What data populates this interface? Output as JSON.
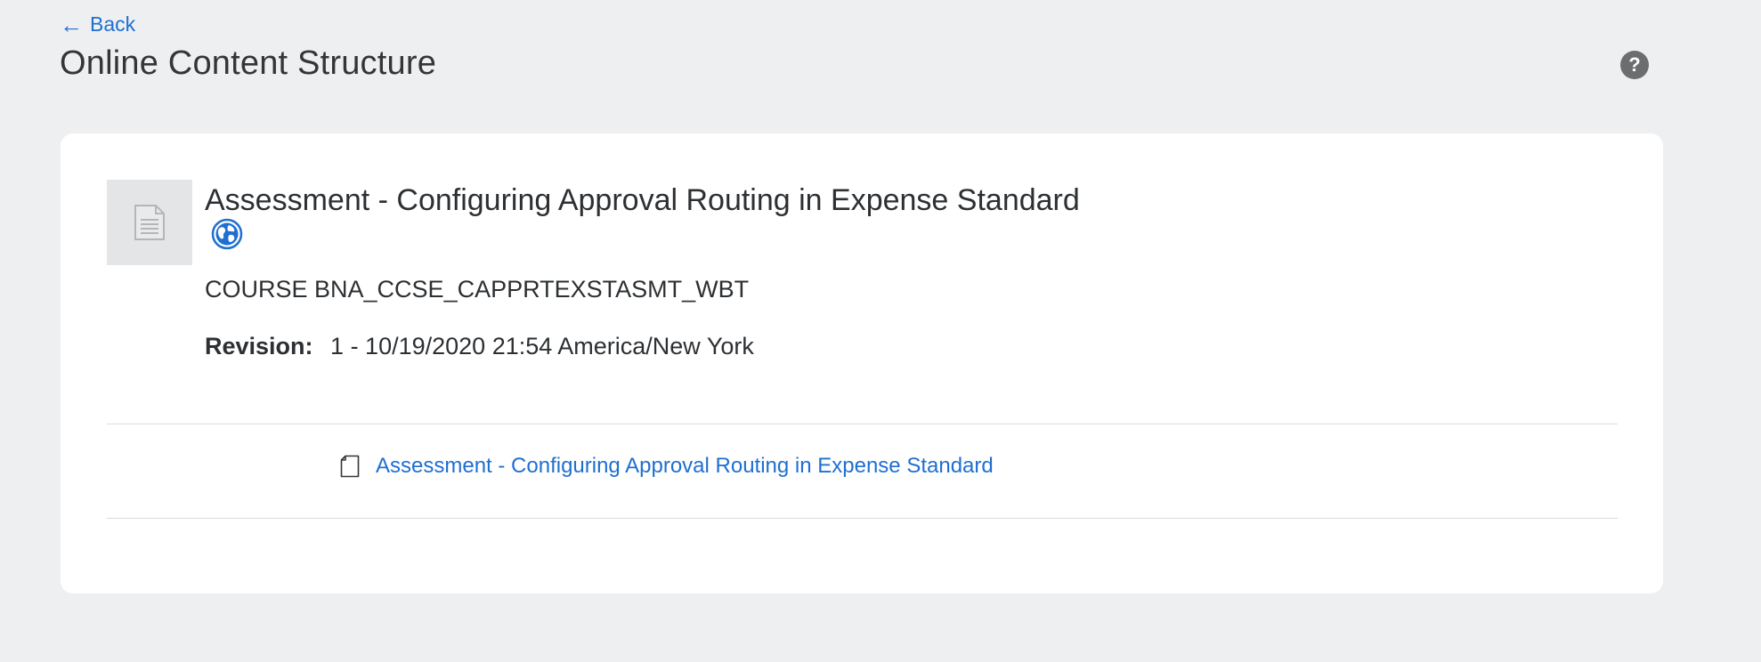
{
  "nav": {
    "back_arrow": "←",
    "back_label": "Back"
  },
  "header": {
    "title": "Online Content Structure",
    "help_symbol": "?"
  },
  "item": {
    "thumbnail_icon": "document-icon",
    "title": "Assessment - Configuring Approval Routing in Expense Standard",
    "globe_icon": "globe-icon",
    "course_code": "COURSE BNA_CCSE_CAPPRTEXSTASMT_WBT",
    "revision_label": "Revision:",
    "revision_value": "1 - 10/19/2020 21:54 America/New York"
  },
  "structure": {
    "items": [
      {
        "icon": "page-icon",
        "label": "Assessment - Configuring Approval Routing in Expense Standard"
      }
    ]
  },
  "colors": {
    "link": "#1f6fd1",
    "background": "#eeeff1",
    "card": "#ffffff",
    "help_icon_bg": "#6c6d6f",
    "globe": "#1f6fd1"
  }
}
